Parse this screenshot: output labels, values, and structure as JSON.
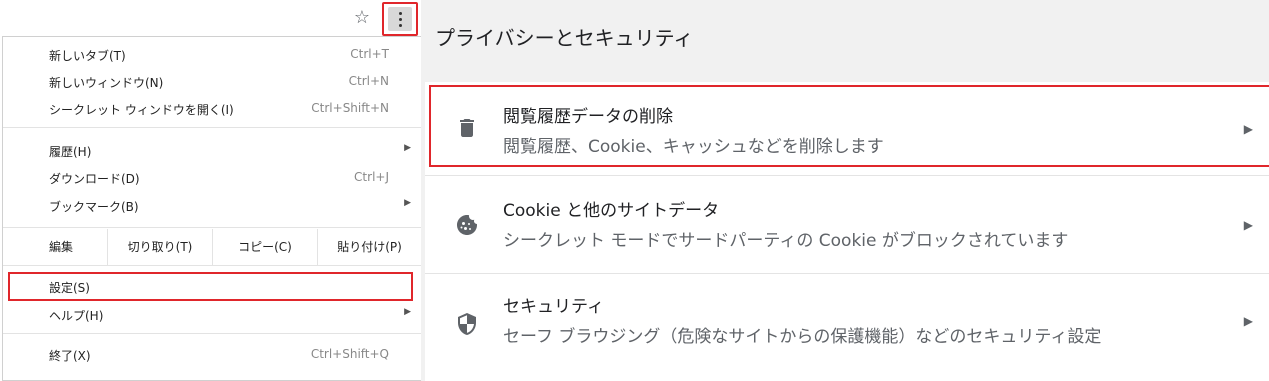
{
  "toolbar": {
    "star_icon": "☆",
    "menu_icon": "kebab-menu-icon"
  },
  "menu": {
    "items": [
      {
        "label": "新しいタブ(T)",
        "shortcut": "Ctrl+T"
      },
      {
        "label": "新しいウィンドウ(N)",
        "shortcut": "Ctrl+N"
      },
      {
        "label": "シークレット ウィンドウを開く(I)",
        "shortcut": "Ctrl+Shift+N"
      },
      {
        "label": "履歴(H)",
        "shortcut": ""
      },
      {
        "label": "ダウンロード(D)",
        "shortcut": "Ctrl+J"
      },
      {
        "label": "ブックマーク(B)",
        "shortcut": ""
      },
      {
        "label": "設定(S)",
        "shortcut": ""
      },
      {
        "label": "ヘルプ(H)",
        "shortcut": ""
      },
      {
        "label": "終了(X)",
        "shortcut": "Ctrl+Shift+Q"
      }
    ],
    "edit": {
      "label": "編集",
      "cut": "切り取り(T)",
      "copy": "コピー(C)",
      "paste": "貼り付け(P)"
    },
    "submenu_arrow": "▶"
  },
  "settings": {
    "page_title": "プライバシーとセキュリティ",
    "rows": [
      {
        "title": "閲覧履歴データの削除",
        "subtitle": "閲覧履歴、Cookie、キャッシュなどを削除します",
        "icon": "trash-icon"
      },
      {
        "title": "Cookie と他のサイトデータ",
        "subtitle": "シークレット モードでサードパーティの Cookie がブロックされています",
        "icon": "cookie-icon"
      },
      {
        "title": "セキュリティ",
        "subtitle": "セーフ ブラウジング（危険なサイトからの保護機能）などのセキュリティ設定",
        "icon": "shield-icon"
      }
    ],
    "chevron": "▶"
  },
  "colors": {
    "highlight": "#e0262b",
    "page_bg": "#f1f1f1"
  }
}
